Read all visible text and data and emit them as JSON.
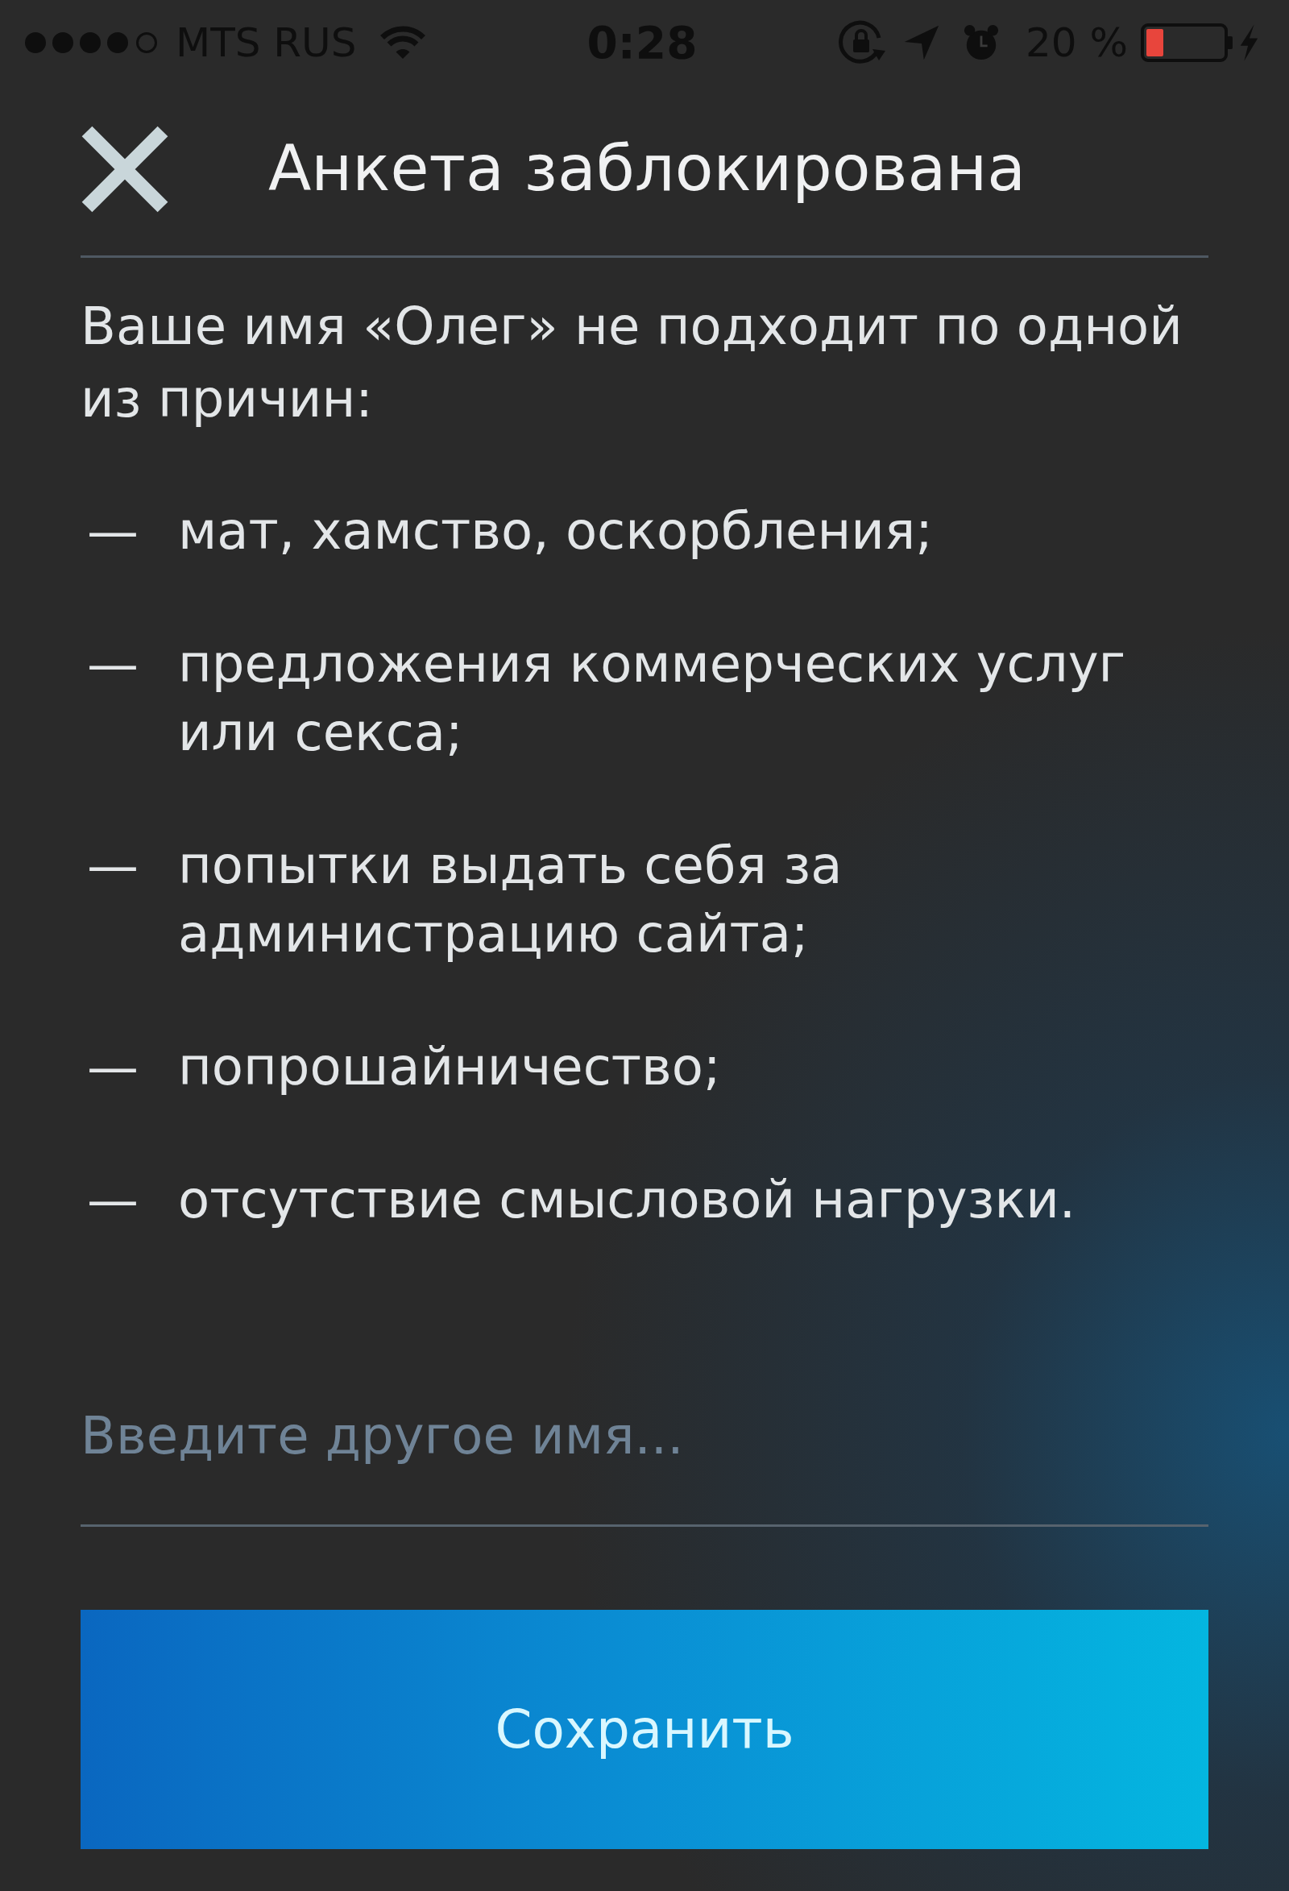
{
  "status_bar": {
    "carrier": "MTS RUS",
    "time": "0:28",
    "battery_percent": "20 %"
  },
  "header": {
    "title": "Анкета заблокирована"
  },
  "message": "Ваше имя «Олег» не подходит по одной из причин:",
  "reasons": [
    {
      "dash": "—",
      "text": "мат, хамство, оскорбления;"
    },
    {
      "dash": "—",
      "text": "предложения коммерческих услуг или секса;"
    },
    {
      "dash": "—",
      "text": "попытки выдать себя за администрацию сайта;"
    },
    {
      "dash": "—",
      "text": "попрошайничество;"
    },
    {
      "dash": "—",
      "text": "отсутствие смысловой нагрузки."
    }
  ],
  "name_field": {
    "placeholder": "Введите другое имя..."
  },
  "save_button": {
    "label": "Сохранить"
  }
}
